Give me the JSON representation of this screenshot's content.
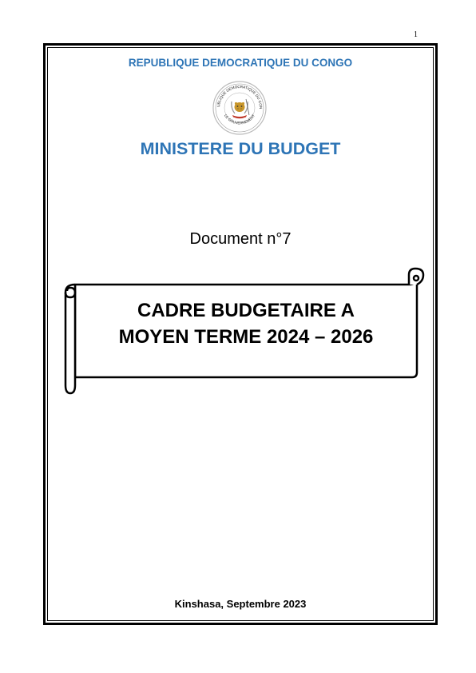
{
  "page": {
    "page_number": "1",
    "republic": "REPUBLIQUE DEMOCRATIQUE DU CONGO",
    "ministry": "MINISTERE DU BUDGET",
    "document_number": "Document n°7",
    "title_line1": "CADRE BUDGETAIRE A",
    "title_line2": "MOYEN TERME 2024 – 2026",
    "footer": "Kinshasa, Septembre 2023"
  },
  "seal": {
    "top_text": "REPUBLIQUE DEMOCRATIQUE DU CONGO",
    "bottom_text": "LE GOUVERNEMENT"
  },
  "colors": {
    "accent_blue": "#2e75b6",
    "text": "#000000"
  }
}
